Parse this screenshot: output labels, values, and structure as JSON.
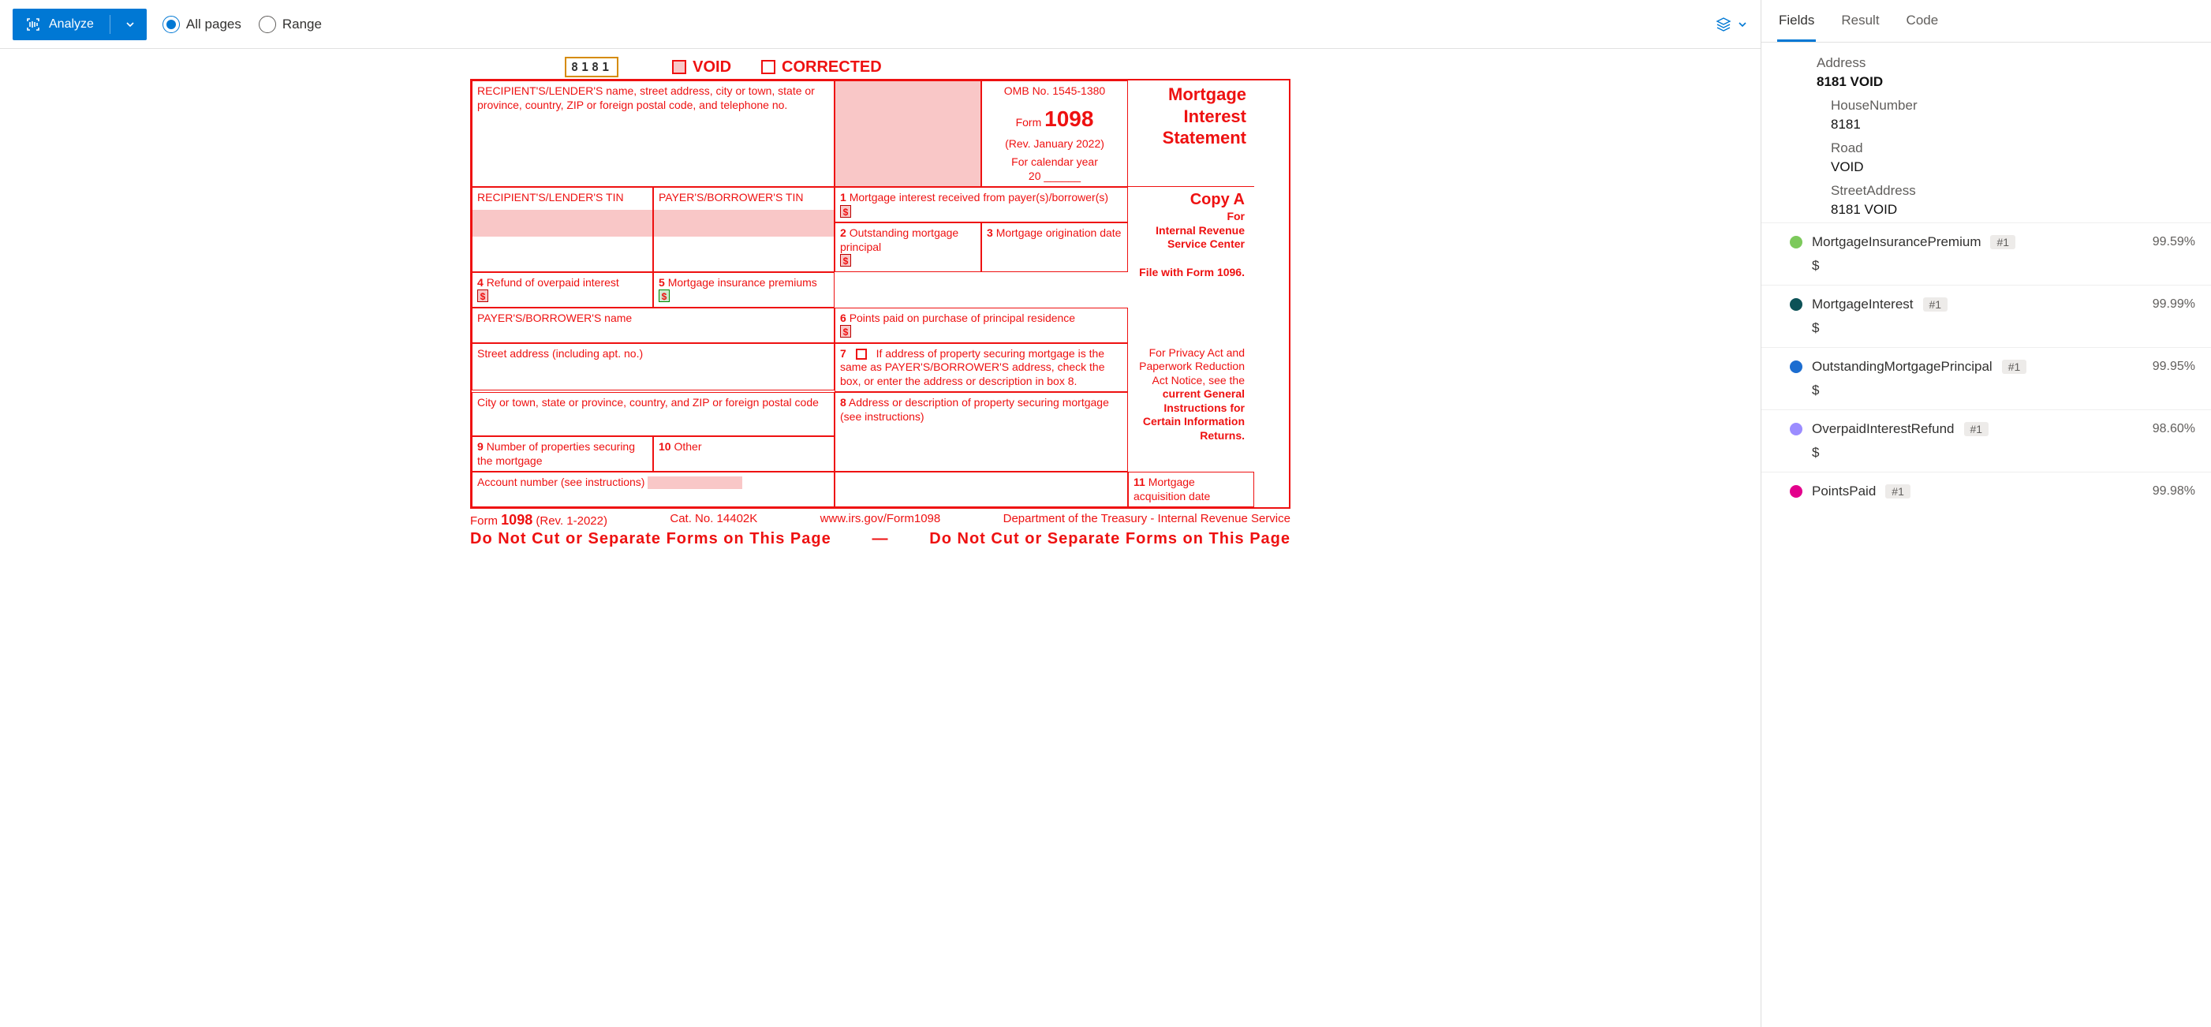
{
  "toolbar": {
    "analyze": "Analyze",
    "allPages": "All pages",
    "range": "Range"
  },
  "form": {
    "code": "8181",
    "void": "VOID",
    "corrected": "CORRECTED",
    "recipientLabel": "RECIPIENT'S/LENDER'S name, street address, city or town, state or province, country, ZIP or foreign postal code, and telephone no.",
    "omb": "OMB No. 1545-1380",
    "formWord": "Form",
    "formNum": "1098",
    "rev": "(Rev. January 2022)",
    "calYear": "For calendar year",
    "yr": "20",
    "title": "Mortgage Interest Statement",
    "b1": "Mortgage interest received from payer(s)/borrower(s)",
    "recipTin": "RECIPIENT'S/LENDER'S TIN",
    "payerTin": "PAYER'S/BORROWER'S TIN",
    "b2": "Outstanding mortgage principal",
    "b3": "Mortgage origination date",
    "copyA": "Copy A",
    "for": "For",
    "irsCenter": "Internal Revenue Service Center",
    "fileWith": "File with Form 1096.",
    "b4": "Refund of overpaid interest",
    "b5": "Mortgage insurance premiums",
    "payerName": "PAYER'S/BORROWER'S name",
    "b6": "Points paid on purchase of principal residence",
    "privacy1": "For Privacy Act and Paperwork Reduction Act Notice, see the",
    "privacy2": "current General Instructions for Certain Information Returns.",
    "street": "Street address (including apt. no.)",
    "b7": "If address of property securing mortgage is the same as PAYER'S/BORROWER'S address, check the box, or enter the address or description in box 8.",
    "city": "City or town, state or province, country, and ZIP or foreign postal code",
    "b8": "Address or description of property securing mortgage (see instructions)",
    "b9": "Number of properties securing the mortgage",
    "b10": "Other",
    "b11": "Mortgage acquisition date",
    "acct": "Account number (see instructions)",
    "footForm": "Form",
    "foot1098": "1098",
    "footRev": "(Rev. 1-2022)",
    "cat": "Cat. No. 14402K",
    "url": "www.irs.gov/Form1098",
    "dept": "Department of the Treasury - Internal Revenue Service",
    "noCutL": "Do   Not   Cut   or   Separate   Forms   on   This   Page",
    "dash": "—",
    "noCutR": "Do   Not   Cut   or   Separate   Forms   on   This   Page"
  },
  "tabs": {
    "fields": "Fields",
    "result": "Result",
    "code": "Code"
  },
  "addr": {
    "title": "Address",
    "val": "8181 VOID",
    "hn": "HouseNumber",
    "hnv": "8181",
    "rd": "Road",
    "rdv": "VOID",
    "sa": "StreetAddress",
    "sav": "8181 VOID"
  },
  "rows": [
    {
      "color": "#7cc95b",
      "name": "MortgageInsurancePremium",
      "badge": "#1",
      "pct": "99.59%",
      "val": "$"
    },
    {
      "color": "#0d5257",
      "name": "MortgageInterest",
      "badge": "#1",
      "pct": "99.99%",
      "val": "$"
    },
    {
      "color": "#1c6dd0",
      "name": "OutstandingMortgagePrincipal",
      "badge": "#1",
      "pct": "99.95%",
      "val": "$"
    },
    {
      "color": "#9b8cff",
      "name": "OverpaidInterestRefund",
      "badge": "#1",
      "pct": "98.60%",
      "val": "$"
    },
    {
      "color": "#e3008c",
      "name": "PointsPaid",
      "badge": "#1",
      "pct": "99.98%",
      "val": ""
    }
  ]
}
